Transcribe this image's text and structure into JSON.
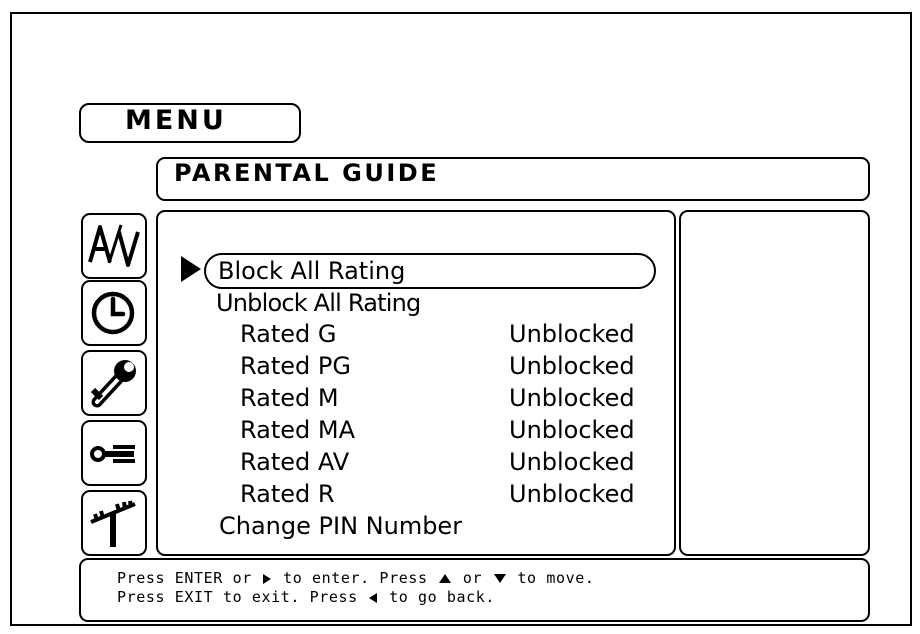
{
  "header": {
    "menu_label": "MENU",
    "section_title": "PARENTAL GUIDE"
  },
  "sidebar": {
    "icons": [
      {
        "name": "av-icon",
        "text": "A/V"
      },
      {
        "name": "clock-icon"
      },
      {
        "name": "wrench-icon"
      },
      {
        "name": "key-icon"
      },
      {
        "name": "antenna-icon"
      }
    ]
  },
  "menu": {
    "selected_index": 0,
    "block_all": "Block All Rating",
    "unblock_all": "Unblock All Rating",
    "ratings": [
      {
        "label": "Rated G",
        "status": "Unblocked"
      },
      {
        "label": "Rated PG",
        "status": "Unblocked"
      },
      {
        "label": "Rated M",
        "status": "Unblocked"
      },
      {
        "label": "Rated MA",
        "status": "Unblocked"
      },
      {
        "label": "Rated AV",
        "status": "Unblocked"
      },
      {
        "label": "Rated R",
        "status": "Unblocked"
      }
    ],
    "change_pin": "Change PIN Number"
  },
  "help": {
    "l1_a": "Press ENTER or",
    "l1_b": "to enter. Press",
    "l1_c": "or",
    "l1_d": "to move.",
    "l2_a": "Press EXIT to exit. Press",
    "l2_b": "to go back."
  }
}
